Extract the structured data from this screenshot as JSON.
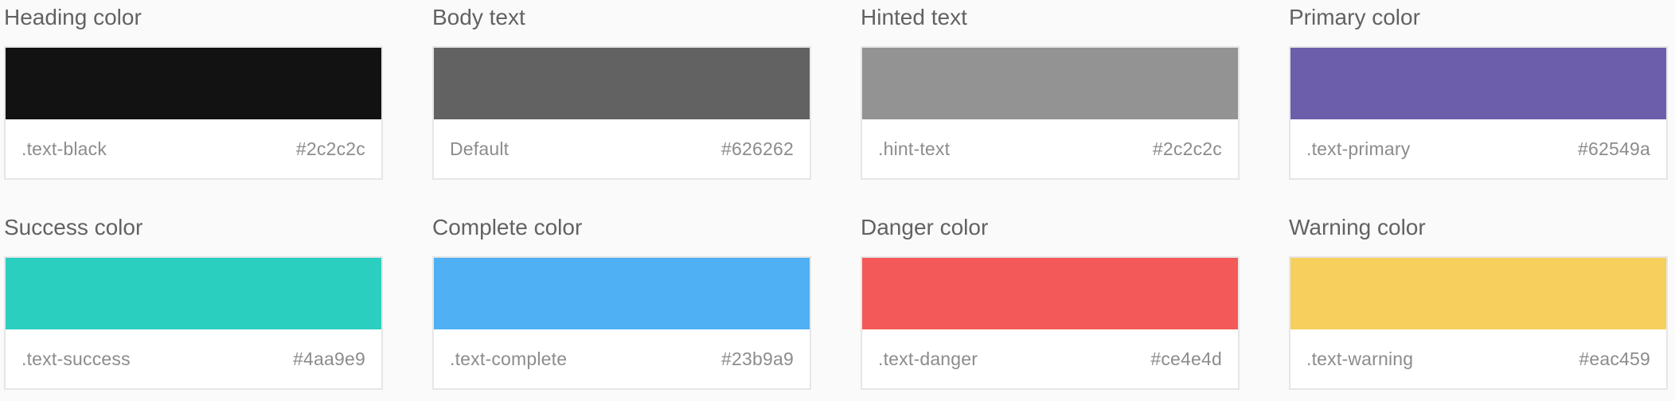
{
  "swatches": [
    {
      "title": "Heading color",
      "class_name": ".text-black",
      "hex": "#2c2c2c",
      "display_color": "#121212"
    },
    {
      "title": "Body text",
      "class_name": "Default",
      "hex": "#626262",
      "display_color": "#626262"
    },
    {
      "title": "Hinted text",
      "class_name": ".hint-text",
      "hex": "#2c2c2c",
      "display_color": "#939393"
    },
    {
      "title": "Primary color",
      "class_name": ".text-primary",
      "hex": "#62549a",
      "display_color": "#6d5eac"
    },
    {
      "title": "Success color",
      "class_name": ".text-success",
      "hex": "#4aa9e9",
      "display_color": "#2acfc0"
    },
    {
      "title": "Complete color",
      "class_name": ".text-complete",
      "hex": "#23b9a9",
      "display_color": "#4fb0f4"
    },
    {
      "title": "Danger color",
      "class_name": ".text-danger",
      "hex": "#ce4e4d",
      "display_color": "#f35958"
    },
    {
      "title": "Warning color",
      "class_name": ".text-warning",
      "hex": "#eac459",
      "display_color": "#f7cf5d"
    }
  ]
}
